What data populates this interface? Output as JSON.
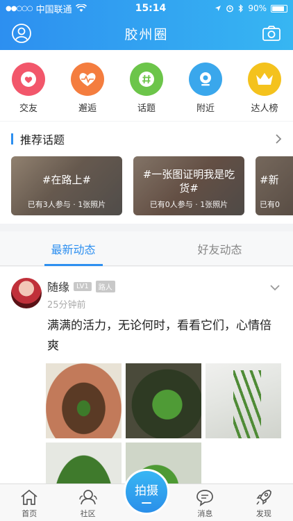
{
  "status": {
    "carrier": "中国联通",
    "time": "15:14",
    "battery": "90%",
    "battery_level": 0.9
  },
  "nav": {
    "title": "胶州圈"
  },
  "categories": [
    {
      "label": "交友",
      "icon": "heart-icon",
      "color": "#f2576b"
    },
    {
      "label": "邂逅",
      "icon": "heartbeat-icon",
      "color": "#f47d3f"
    },
    {
      "label": "话题",
      "icon": "hash-icon",
      "color": "#6cc54a"
    },
    {
      "label": "附近",
      "icon": "location-icon",
      "color": "#3aa7ec"
    },
    {
      "label": "达人榜",
      "icon": "crown-icon",
      "color": "#f4c21d"
    }
  ],
  "topics": {
    "title": "推荐话题",
    "cards": [
      {
        "name": "#在路上#",
        "meta": "已有3人参与 · 1张照片"
      },
      {
        "name": "#一张图证明我是吃货#",
        "meta": "已有0人参与 · 1张照片"
      },
      {
        "name": "#新",
        "meta": "已有0"
      }
    ]
  },
  "tabs": {
    "latest": "最新动态",
    "friends": "好友动态"
  },
  "post": {
    "username": "随缘",
    "level": "LV1",
    "tag": "路人",
    "time": "25分钟前",
    "text": "满满的活力，无论何时，看看它们，心情倍爽"
  },
  "tabbar": {
    "home": "首页",
    "community": "社区",
    "shoot": "拍摄",
    "messages": "消息",
    "discover": "发现"
  },
  "colors": {
    "accent": "#2d8ff0"
  }
}
